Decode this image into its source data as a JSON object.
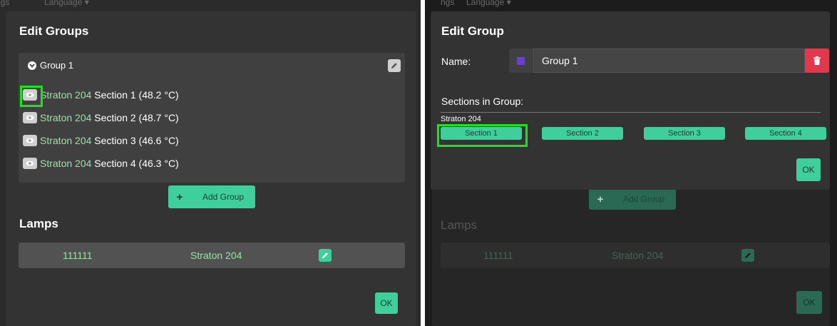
{
  "left": {
    "topbar": {
      "text_a": "ngs",
      "text_b": "Language ▾"
    },
    "title": "Edit Groups",
    "group": {
      "name": "Group 1",
      "rows": [
        {
          "lamp": "Straton 204",
          "section": "Section 1 (48.2 °C)"
        },
        {
          "lamp": "Straton 204",
          "section": "Section 2 (48.7 °C)"
        },
        {
          "lamp": "Straton 204",
          "section": "Section 3 (46.6 °C)"
        },
        {
          "lamp": "Straton 204",
          "section": "Section 4 (46.3 °C)"
        }
      ]
    },
    "add_group": {
      "icon": "+",
      "label": "Add Group"
    },
    "lamps_heading": "Lamps",
    "lamp_row": {
      "id": "111111",
      "name": "Straton 204"
    },
    "ok": "OK"
  },
  "right": {
    "topbar": {
      "text_a": "ngs",
      "text_b": "Language ▾"
    },
    "title": "Edit Group",
    "name_label": "Name:",
    "name_value": "Group 1",
    "group_color": "#6b3fd6",
    "sections_heading": "Sections in Group:",
    "lamp_name": "Straton 204",
    "sections": [
      "Section 1",
      "Section 2",
      "Section 3",
      "Section 4"
    ],
    "ok": "OK",
    "bg_add_group": {
      "icon": "+",
      "label": "Add Group"
    },
    "bg_lamps_heading": "Lamps",
    "bg_lamp_row": {
      "id": "111111",
      "name": "Straton 204"
    },
    "bg_ok": "OK"
  },
  "colors": {
    "accent": "#3fcf9c",
    "focus": "#19e619",
    "delete": "#e0394d",
    "green_text": "#9ae0a8"
  }
}
